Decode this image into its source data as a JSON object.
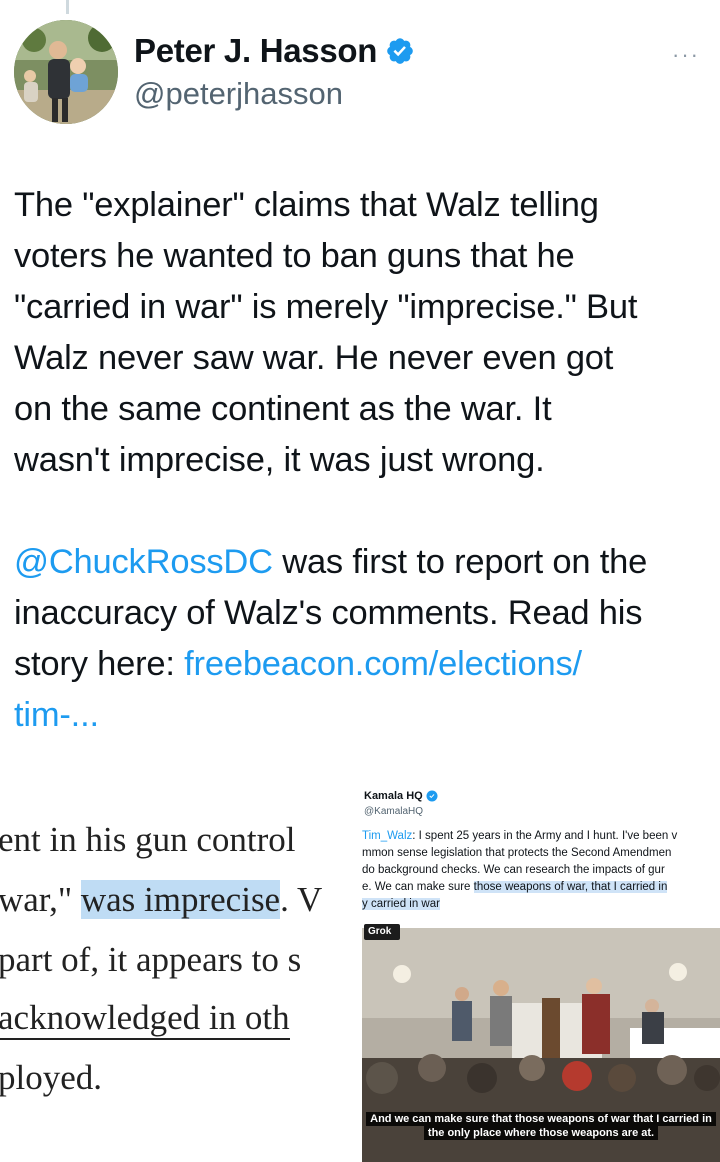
{
  "author": {
    "display_name": "Peter J. Hasson",
    "handle": "@peterjhasson"
  },
  "more_label": "···",
  "tweet": {
    "paragraph1": [
      "The \"explainer\" claims that Walz telling",
      "voters he wanted to ban guns that he",
      "\"carried in war\" is merely \"imprecise.\" But",
      "Walz never saw war. He never even got",
      "on the same continent as the war. It",
      "wasn't imprecise, it was just wrong."
    ],
    "mention": "@ChuckRossDC",
    "line7_rest": " was first to report on the",
    "line8": "inaccuracy of Walz's comments. Read his",
    "line9_prefix": "story here: ",
    "link_part1": "freebeacon.com/elections/",
    "link_part2": "tim-..."
  },
  "media_left": {
    "line1": "ent in his gun control",
    "line2_pre": "war,\" ",
    "line2_hl": "was imprecise",
    "line2_post": ". V",
    "line3": "part of, it appears to s",
    "line4": "acknowledged in oth",
    "line5": "ployed."
  },
  "media_right": {
    "account_name": "Kamala HQ",
    "account_handle": "@KamalaHQ",
    "quote_mention": "Tim_Walz",
    "quote_line1_rest": ": I spent 25 years in the Army and I hunt. I've been v",
    "quote_line2": "mmon sense legislation that protects the Second Amendmen",
    "quote_line3": " do background checks. We can research the impacts of gur",
    "quote_line4_pre": "e. We can make sure ",
    "quote_line4_hl": "those weapons of war, that I carried in",
    "quote_line5_hl": "y carried in war",
    "grok_label": "Grok",
    "caption_line1": "And we can make sure that those weapons of war that I carried in",
    "caption_line2": "the only place where those weapons are at."
  },
  "colors": {
    "link": "#1d9bf0",
    "verified": "#1d9bf0",
    "highlight": "#bfdcf4",
    "text": "#0f1419",
    "secondary": "#536471"
  },
  "icons": {
    "verified": "verified-badge-icon",
    "more": "more-icon"
  }
}
